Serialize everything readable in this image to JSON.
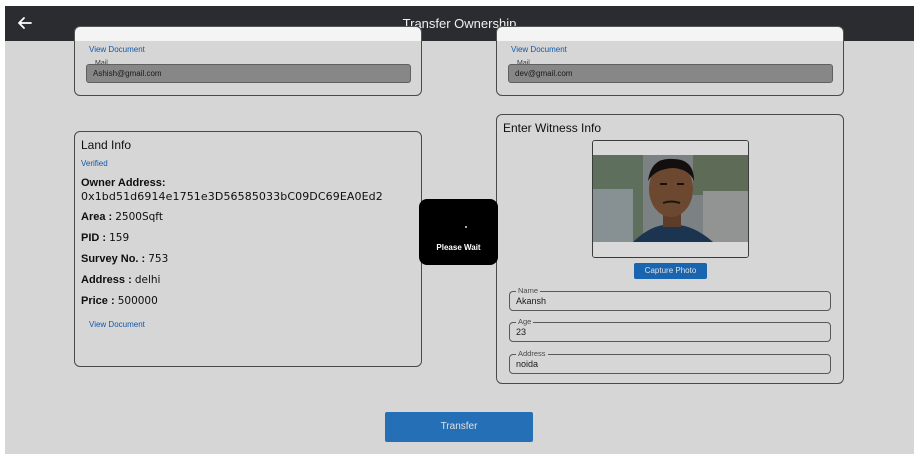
{
  "appbar": {
    "title": "Transfer Ownership",
    "back_icon": "arrow-left-icon"
  },
  "seller_card": {
    "view_document": "View Document",
    "mail_label": "Mail",
    "mail_value": "Ashish@gmail.com"
  },
  "buyer_card": {
    "view_document": "View Document",
    "mail_label": "Mail",
    "mail_value": "dev@gmail.com"
  },
  "land_info": {
    "title": "Land Info",
    "status": "Verified",
    "owner_address_label": "Owner Address:",
    "owner_address_value": "0x1bd51d6914e1751e3D56585033bC09DC69EA0Ed2",
    "area_label": "Area :",
    "area_value": "2500Sqft",
    "pid_label": "PID :",
    "pid_value": "159",
    "survey_label": "Survey No. :",
    "survey_value": "753",
    "address_label": "Address :",
    "address_value": "delhi",
    "price_label": "Price :",
    "price_value": "500000",
    "view_document": "View Document"
  },
  "witness": {
    "title": "Enter Witness Info",
    "capture_label": "Capture Photo",
    "fields": [
      {
        "label": "Name",
        "value": "Akansh"
      },
      {
        "label": "Age",
        "value": "23"
      },
      {
        "label": "Address",
        "value": "noida"
      }
    ]
  },
  "loading": {
    "text": "Please Wait"
  },
  "actions": {
    "transfer_label": "Transfer"
  },
  "colors": {
    "appbar": "#2b2c30",
    "accent": "#1e73c8",
    "link": "#1565c0"
  }
}
